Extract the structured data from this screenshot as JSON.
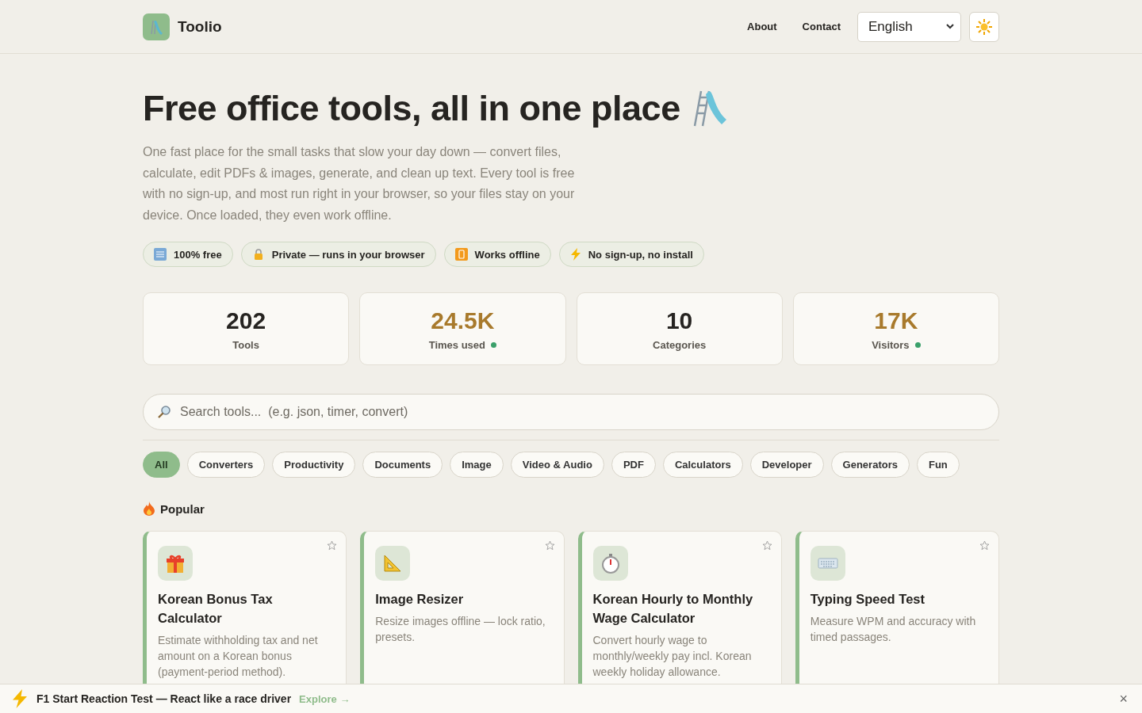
{
  "header": {
    "brand": "Toolio",
    "nav": [
      "About",
      "Contact"
    ],
    "language": "English"
  },
  "hero": {
    "title": "Free office tools, all in one place",
    "description": "One fast place for the small tasks that slow your day down — convert files, calculate, edit PDFs & images, generate, and clean up text. Every tool is free with no sign-up, and most run right in your browser, so your files stay on your device. Once loaded, they even work offline."
  },
  "badges": [
    {
      "kind": "free",
      "label": "100% free"
    },
    {
      "kind": "lock",
      "label": "Private — runs in your browser"
    },
    {
      "kind": "offline",
      "label": "Works offline"
    },
    {
      "kind": "bolt",
      "label": "No sign-up, no install"
    }
  ],
  "stats": [
    {
      "value": "202",
      "label": "Tools",
      "live": false
    },
    {
      "value": "24.5K",
      "label": "Times used",
      "live": true
    },
    {
      "value": "10",
      "label": "Categories",
      "live": false
    },
    {
      "value": "17K",
      "label": "Visitors",
      "live": true
    }
  ],
  "search": {
    "placeholder": "Search tools...  (e.g. json, timer, convert)"
  },
  "categories": [
    {
      "label": "All",
      "selected": true
    },
    {
      "label": "Converters",
      "selected": false
    },
    {
      "label": "Productivity",
      "selected": false
    },
    {
      "label": "Documents",
      "selected": false
    },
    {
      "label": "Image",
      "selected": false
    },
    {
      "label": "Video & Audio",
      "selected": false
    },
    {
      "label": "PDF",
      "selected": false
    },
    {
      "label": "Calculators",
      "selected": false
    },
    {
      "label": "Developer",
      "selected": false
    },
    {
      "label": "Generators",
      "selected": false
    },
    {
      "label": "Fun",
      "selected": false
    }
  ],
  "popular": {
    "heading": "Popular",
    "tools": [
      {
        "kind": "gift",
        "title": "Korean Bonus Tax Calculator",
        "description": "Estimate withholding tax and net amount on a Korean bonus (payment-period method).",
        "favorite": false
      },
      {
        "kind": "ruler",
        "title": "Image Resizer",
        "description": "Resize images offline — lock ratio, presets.",
        "favorite": false
      },
      {
        "kind": "stopwatch",
        "title": "Korean Hourly to Monthly Wage Calculator",
        "description": "Convert hourly wage to monthly/weekly pay incl. Korean weekly holiday allowance.",
        "favorite": false
      },
      {
        "kind": "keyboard",
        "title": "Typing Speed Test",
        "description": "Measure WPM and accuracy with timed passages.",
        "favorite": false
      }
    ]
  },
  "banner": {
    "text": "F1 Start Reaction Test — React like a race driver",
    "link": "Explore →",
    "close": "×"
  }
}
